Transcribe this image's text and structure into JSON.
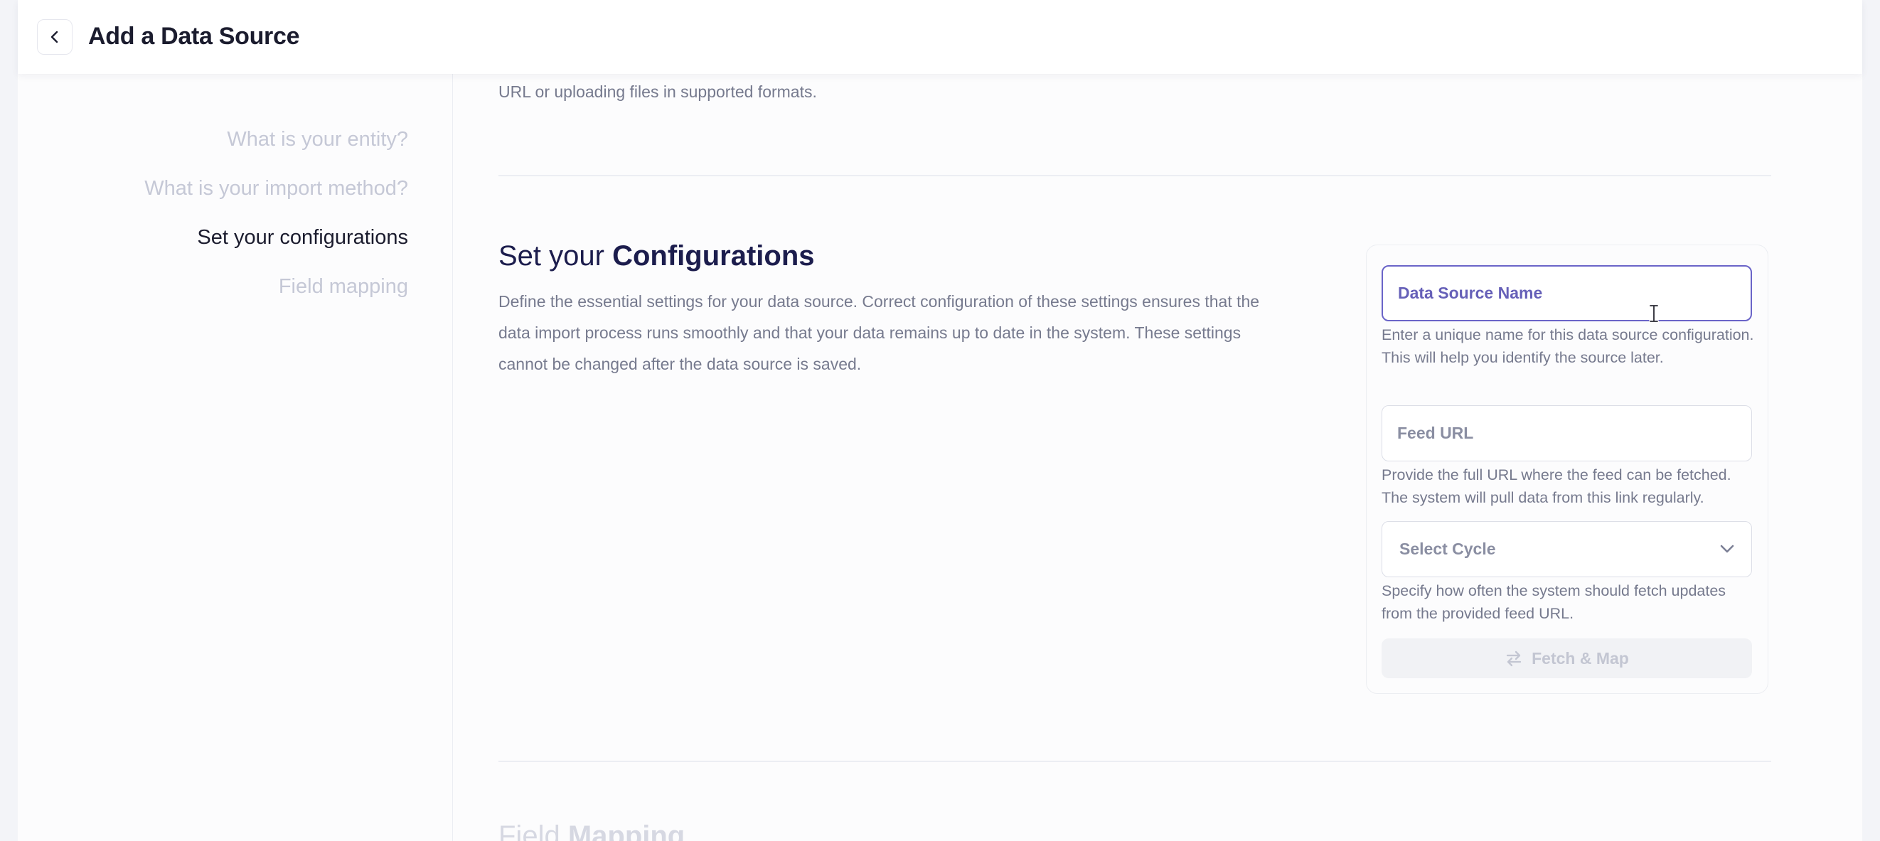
{
  "header": {
    "title": "Add a Data Source"
  },
  "intro": {
    "tail_text": "URL or uploading files in supported formats."
  },
  "steps": [
    {
      "label": "What is your entity?",
      "state": "done"
    },
    {
      "label": "What is your import method?",
      "state": "done"
    },
    {
      "label": "Set your configurations",
      "state": "active"
    },
    {
      "label": "Field mapping",
      "state": "upcoming"
    }
  ],
  "config_section": {
    "title_light": "Set your ",
    "title_bold": "Configurations",
    "description": "Define the essential settings for your data source. Correct configuration of these settings ensures that the data import process runs smoothly and that your data remains up to date in the system. These settings cannot be changed after the data source is saved."
  },
  "form": {
    "name_field": {
      "placeholder": "Data Source Name",
      "value": "",
      "helper": "Enter a unique name for this data source configuration. This will help you identify the source later."
    },
    "feed_url_field": {
      "placeholder": "Feed URL",
      "value": "",
      "helper": "Provide the full URL where the feed can be fetched. The system will pull data from this link regularly."
    },
    "cycle_select": {
      "placeholder": "Select Cycle",
      "helper": "Specify how often the system should fetch updates from the provided feed URL."
    },
    "fetch_button": {
      "label": "Fetch & Map",
      "enabled": false
    }
  },
  "next_section": {
    "title_light": "Field ",
    "title_bold": "Mapping"
  },
  "colors": {
    "accent": "#6a64c8",
    "title_navy": "#1c1d4d",
    "muted_text": "#767a8e",
    "step_muted": "#c5c8d6"
  },
  "icons": {
    "back": "chevron-left-icon",
    "select": "chevron-down-icon",
    "fetch": "swap-arrows-icon",
    "cursor": "text-cursor-icon"
  }
}
